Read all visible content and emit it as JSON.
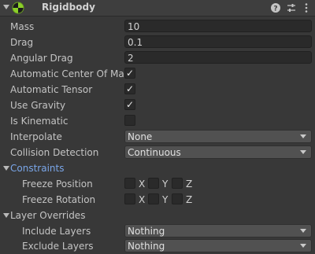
{
  "component": {
    "title": "Rigidbody",
    "enabled_icon": "rigidbody-sphere-icon",
    "header_icons": [
      "help-icon",
      "presets-icon",
      "more-options-icon"
    ]
  },
  "properties": {
    "mass": {
      "label": "Mass",
      "value": "10"
    },
    "drag": {
      "label": "Drag",
      "value": "0.1"
    },
    "angular_drag": {
      "label": "Angular Drag",
      "value": "2"
    },
    "automatic_center_of_mass": {
      "label": "Automatic Center Of Mass",
      "checked": true
    },
    "automatic_tensor": {
      "label": "Automatic Tensor",
      "checked": true
    },
    "use_gravity": {
      "label": "Use Gravity",
      "checked": true
    },
    "is_kinematic": {
      "label": "Is Kinematic",
      "checked": false
    },
    "interpolate": {
      "label": "Interpolate",
      "value": "None"
    },
    "collision_detection": {
      "label": "Collision Detection",
      "value": "Continuous"
    }
  },
  "constraints": {
    "label": "Constraints",
    "freeze_position": {
      "label": "Freeze Position",
      "axes": [
        "X",
        "Y",
        "Z"
      ],
      "checked": [
        false,
        false,
        false
      ]
    },
    "freeze_rotation": {
      "label": "Freeze Rotation",
      "axes": [
        "X",
        "Y",
        "Z"
      ],
      "checked": [
        false,
        false,
        false
      ]
    }
  },
  "layer_overrides": {
    "label": "Layer Overrides",
    "include_layers": {
      "label": "Include Layers",
      "value": "Nothing"
    },
    "exclude_layers": {
      "label": "Exclude Layers",
      "value": "Nothing"
    }
  },
  "colors": {
    "background": "#383838",
    "header": "#3e3e3e",
    "link": "#7aa6e8",
    "field": "#2a2a2a",
    "dropdown": "#515151"
  }
}
